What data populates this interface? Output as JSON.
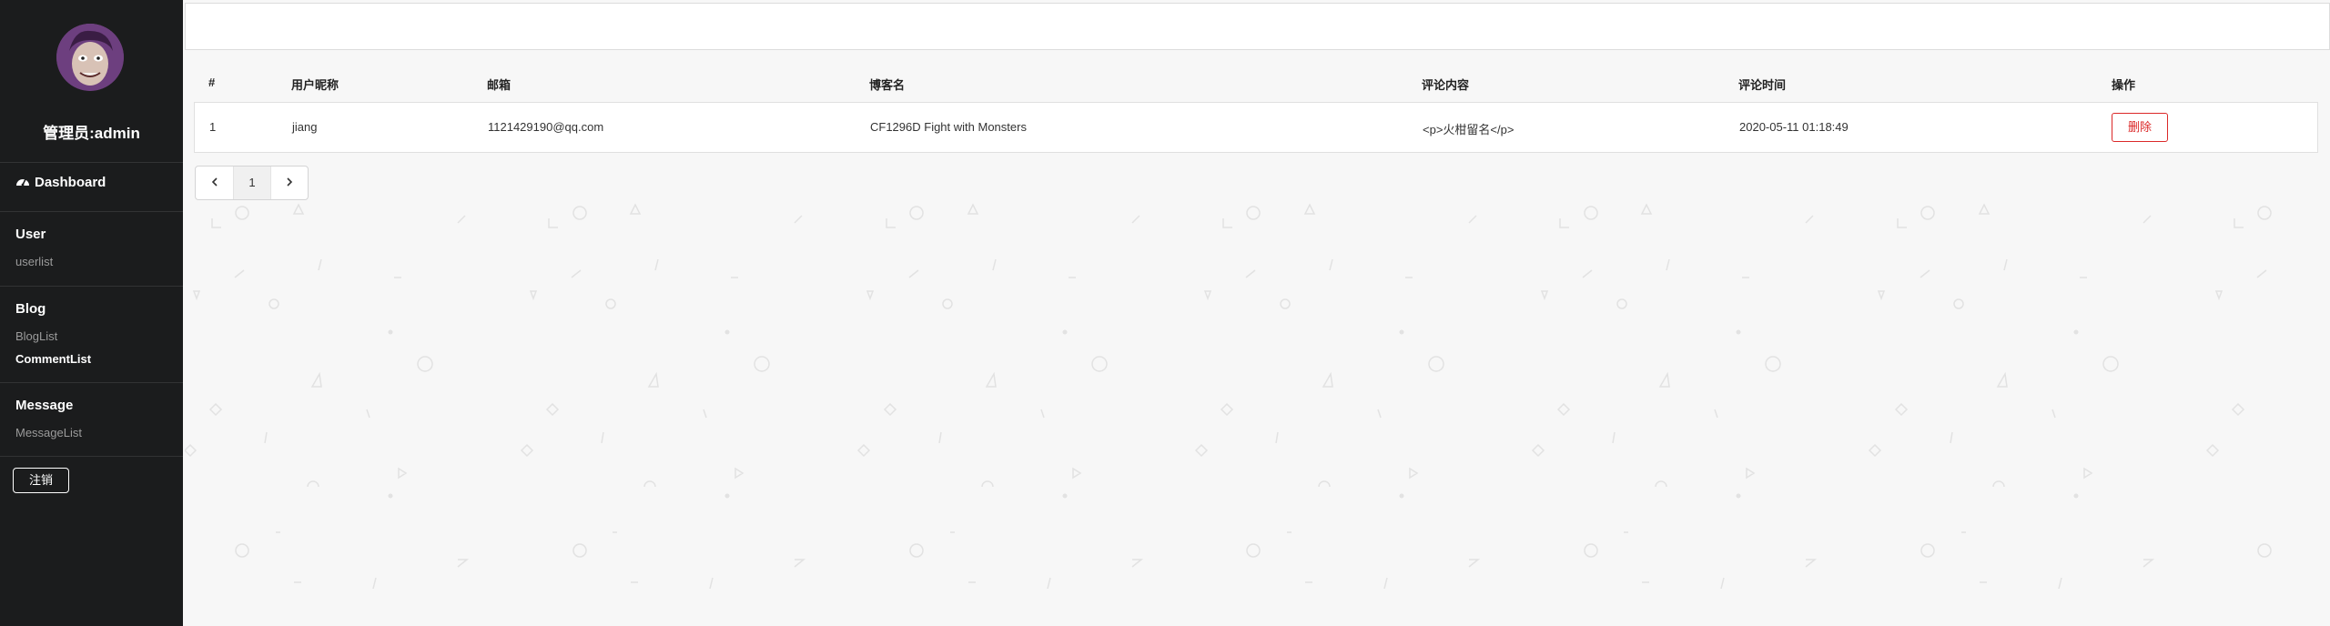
{
  "sidebar": {
    "admin_label": "管理员:admin",
    "dashboard": {
      "icon": "dashboard-icon",
      "label": "Dashboard"
    },
    "sections": [
      {
        "title": "User",
        "items": [
          {
            "label": "userlist",
            "active": false
          }
        ]
      },
      {
        "title": "Blog",
        "items": [
          {
            "label": "BlogList",
            "active": false
          },
          {
            "label": "CommentList",
            "active": true
          }
        ]
      },
      {
        "title": "Message",
        "items": [
          {
            "label": "MessageList",
            "active": false
          }
        ]
      }
    ],
    "logout_label": "注销"
  },
  "table": {
    "headers": [
      "#",
      "用户昵称",
      "邮箱",
      "博客名",
      "评论内容",
      "评论时间",
      "操作"
    ],
    "rows": [
      {
        "index": "1",
        "nickname": "jiang",
        "email": "1121429190@qq.com",
        "blog": "CF1296D Fight with Monsters",
        "content": "<p>火柑留名</p>",
        "time": "2020-05-11 01:18:49",
        "action": "删除"
      }
    ]
  },
  "pagination": {
    "prev_icon": "chevron-left-icon",
    "pages": [
      "1"
    ],
    "current": "1",
    "next_icon": "chevron-right-icon"
  },
  "colors": {
    "sidebar_bg": "#1b1c1d",
    "danger": "#db2828",
    "page_bg": "#f7f7f7"
  }
}
